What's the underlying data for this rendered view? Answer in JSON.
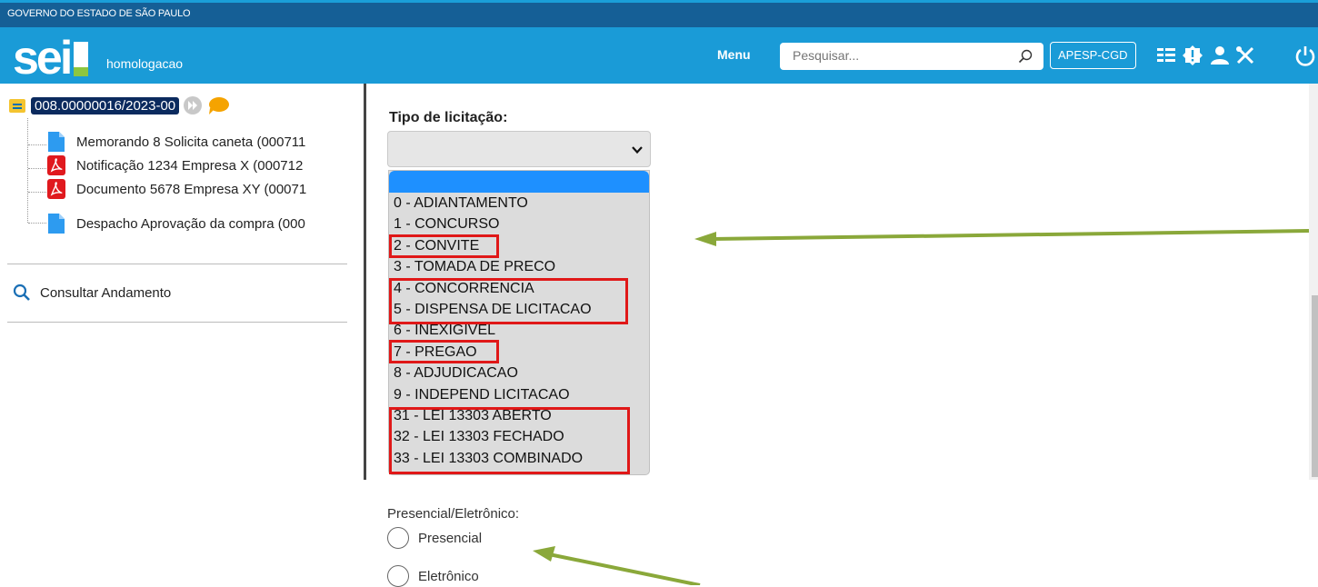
{
  "header": {
    "government": "GOVERNO DO ESTADO DE SÃO PAULO",
    "logo_text": "sei",
    "environment": "homologacao",
    "menu_label": "Menu",
    "search_placeholder": "Pesquisar...",
    "unit": "APESP-CGD",
    "icons": [
      "list-icon",
      "alert-icon",
      "user-icon",
      "tools-icon",
      "power-icon"
    ]
  },
  "tree": {
    "process_number": "008.00000016/2023-00",
    "documents": [
      {
        "label": "Memorando 8 Solicita caneta (000711",
        "icon": "document-icon"
      },
      {
        "label": "Notificação 1234 Empresa X (000712",
        "icon": "pdf-icon"
      },
      {
        "label": "Documento 5678 Empresa XY (00071",
        "icon": "pdf-icon"
      },
      {
        "label": "Despacho Aprovação da compra (000",
        "icon": "document-icon"
      }
    ],
    "consult_label": "Consultar Andamento"
  },
  "form": {
    "type_label": "Tipo de licitação:",
    "selected_value": "",
    "options": [
      "0 - ADIANTAMENTO",
      "1 - CONCURSO",
      "2 - CONVITE",
      "3 - TOMADA DE PRECO",
      "4 - CONCORRENCIA",
      "5 - DISPENSA DE LICITACAO",
      "6 - INEXIGIVEL",
      "7 - PREGAO",
      "8 - ADJUDICACAO",
      "9 - INDEPEND LICITACAO",
      "31 - LEI 13303 ABERTO",
      "32 - LEI 13303 FECHADO",
      "33 - LEI 13303 COMBINADO"
    ],
    "highlighted_options": [
      "2 - CONVITE",
      "4 - CONCORRENCIA",
      "5 - DISPENSA DE LICITACAO",
      "7 - PREGAO",
      "31 - LEI 13303 ABERTO",
      "32 - LEI 13303 FECHADO",
      "33 - LEI 13303 COMBINADO"
    ],
    "mode_label": "Presencial/Eletrônico:",
    "mode_options": [
      "Presencial",
      "Eletrônico"
    ]
  },
  "colors": {
    "header_blue": "#1a9bd7",
    "gov_bar": "#155f96",
    "highlight_red": "#e01818",
    "arrow_green": "#8aa83a",
    "selected_option": "#1e90ff"
  }
}
